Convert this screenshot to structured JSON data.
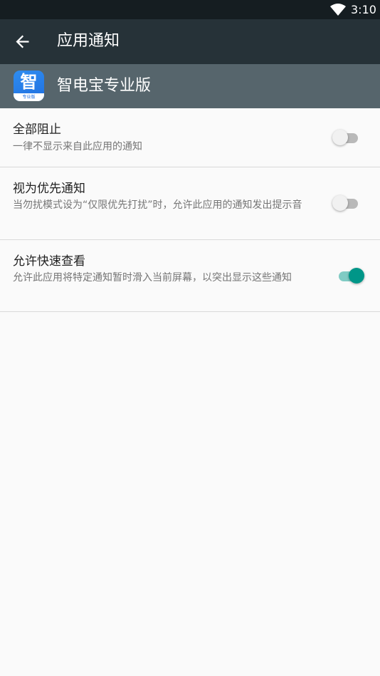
{
  "status_bar": {
    "time": "3:10",
    "wifi_icon": "wifi-icon"
  },
  "toolbar": {
    "back_icon": "arrow-back-icon",
    "title": "应用通知"
  },
  "app_header": {
    "icon_glyph": "智",
    "icon_band_text": "专业版",
    "name": "智电宝专业版"
  },
  "preferences": [
    {
      "title": "全部阻止",
      "summary": "一律不显示来自此应用的通知",
      "checked": false
    },
    {
      "title": "视为优先通知",
      "summary": "当勿扰模式设为“仅限优先打扰”时，允许此应用的通知发出提示音",
      "checked": false
    },
    {
      "title": "允许快速查看",
      "summary": "允许此应用将特定通知暂时滑入当前屏幕，以突出显示这些通知",
      "checked": true
    }
  ],
  "colors": {
    "status_bar": "#151d21",
    "toolbar": "#263238",
    "app_header": "#56656c",
    "switch_on": "#009688",
    "switch_on_track": "#80cbc4"
  }
}
